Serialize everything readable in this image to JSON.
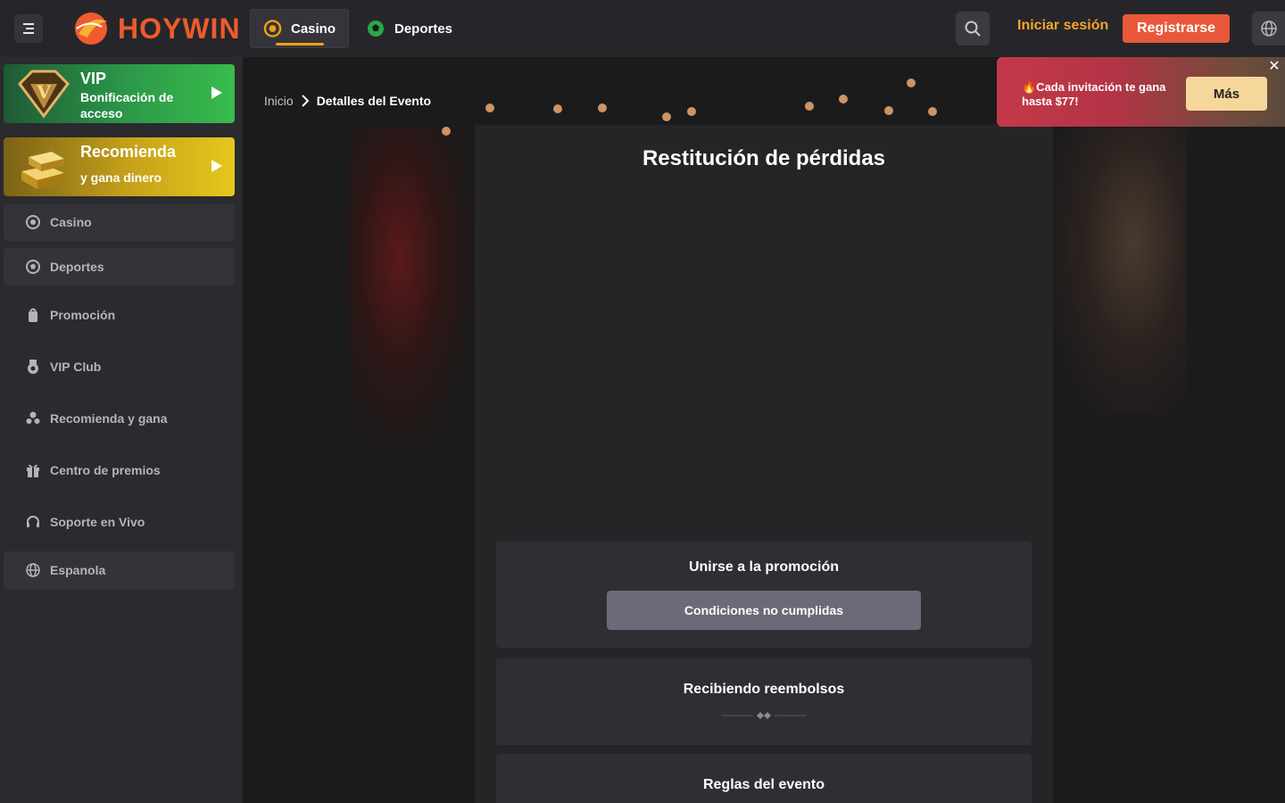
{
  "header": {
    "logo_text": "HOYWIN",
    "tabs": [
      {
        "label": "Casino",
        "active": true
      },
      {
        "label": "Deportes",
        "active": false
      }
    ],
    "login_label": "Iniciar sesión",
    "register_label": "Registrarse"
  },
  "sidebar": {
    "vip_card": {
      "title": "VIP",
      "subtitle": "Bonificación de acceso"
    },
    "referral_card": {
      "title": "Recomienda",
      "subtitle": "y gana dinero"
    },
    "items": [
      {
        "label": "Casino",
        "icon": "casino-chip-icon"
      },
      {
        "label": "Deportes",
        "icon": "soccer-ball-icon"
      },
      {
        "label": "Promoción",
        "icon": "promo-bag-icon"
      },
      {
        "label": "VIP Club",
        "icon": "vip-medal-icon"
      },
      {
        "label": "Recomienda y gana",
        "icon": "users-icon"
      },
      {
        "label": "Centro de premios",
        "icon": "gift-icon"
      },
      {
        "label": "Soporte en Vivo",
        "icon": "headset-icon"
      },
      {
        "label": "Espanola",
        "icon": "globe-icon"
      }
    ]
  },
  "breadcrumb": {
    "home": "Inicio",
    "current": "Detalles del Evento"
  },
  "event": {
    "title": "Restitución de pérdidas",
    "join": {
      "title": "Unirse a la promoción",
      "button_label": "Condiciones no cumplidas"
    },
    "refunds": {
      "title": "Recibiendo reembolsos"
    },
    "rules": {
      "title": "Reglas del evento"
    }
  },
  "toast": {
    "text": "🔥Cada invitación te gana hasta $77!",
    "button_label": "Más",
    "close_label": "✕"
  },
  "colors": {
    "accent": "#f0a012",
    "register": "#e9583a",
    "vip_green": "#39bb4c",
    "referral_gold": "#e6c71c"
  }
}
